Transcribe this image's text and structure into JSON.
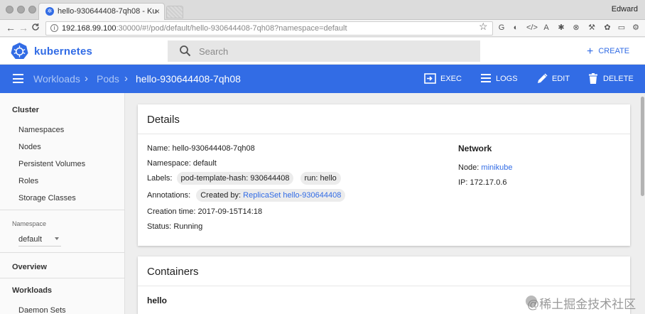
{
  "browser": {
    "tab_title": "hello-930644408-7qh08 - Ku",
    "tab_close": "×",
    "profile": "Edward",
    "url_host": "192.168.99.100",
    "url_rest": ":30000/#!/pod/default/hello-930644408-7qh08?namespace=default",
    "back_glyph": "←",
    "forward_glyph": "→",
    "reload_glyph": "C",
    "star_glyph": "☆",
    "info_glyph": "i",
    "extensions": [
      {
        "name": "translate-extension-icon",
        "glyph": "G"
      },
      {
        "name": "adblock-extension-icon",
        "glyph": "◐"
      },
      {
        "name": "dev-extension-icon",
        "glyph": "</>"
      },
      {
        "name": "readability-extension-icon",
        "glyph": "A"
      },
      {
        "name": "pinwheel-extension-icon",
        "glyph": "✱"
      },
      {
        "name": "chrome-extension-icon",
        "glyph": "⊗"
      },
      {
        "name": "tools-extension-icon",
        "glyph": "⚒"
      },
      {
        "name": "puzzle-extension-icon",
        "glyph": "✿"
      },
      {
        "name": "cast-extension-icon",
        "glyph": "▭"
      },
      {
        "name": "settings-extension-icon",
        "glyph": "⚙"
      },
      {
        "name": "menu-dots-icon",
        "glyph": "⋮"
      }
    ]
  },
  "header": {
    "brand": "kubernetes",
    "search_placeholder": "Search",
    "create_label": "CREATE",
    "create_glyph": "+"
  },
  "actionbar": {
    "breadcrumb": [
      "Workloads",
      "Pods",
      "hello-930644408-7qh08"
    ],
    "separator": "›",
    "actions": {
      "exec": "EXEC",
      "logs": "LOGS",
      "edit": "EDIT",
      "delete": "DELETE"
    }
  },
  "sidebar": {
    "cluster_heading": "Cluster",
    "cluster_items": [
      "Namespaces",
      "Nodes",
      "Persistent Volumes",
      "Roles",
      "Storage Classes"
    ],
    "namespace_label": "Namespace",
    "namespace_value": "default",
    "overview": "Overview",
    "workloads": "Workloads",
    "workload_items": [
      "Daemon Sets"
    ]
  },
  "details": {
    "title": "Details",
    "name_label": "Name:",
    "name_value": "hello-930644408-7qh08",
    "namespace_label": "Namespace:",
    "namespace_value": "default",
    "labels_label": "Labels:",
    "labels": [
      "pod-template-hash: 930644408",
      "run: hello"
    ],
    "annotations_label": "Annotations:",
    "annotation_prefix": "Created by:",
    "annotation_link": "ReplicaSet hello-930644408",
    "creation_label": "Creation time:",
    "creation_value": "2017-09-15T14:18",
    "status_label": "Status:",
    "status_value": "Running",
    "network_title": "Network",
    "node_label": "Node:",
    "node_value": "minikube",
    "ip_label": "IP:",
    "ip_value": "172.17.0.6"
  },
  "containers": {
    "title": "Containers",
    "first_name": "hello"
  },
  "watermark": "@稀土掘金技术社区",
  "colors": {
    "accent": "#326ce5",
    "background": "#eeeeee"
  }
}
